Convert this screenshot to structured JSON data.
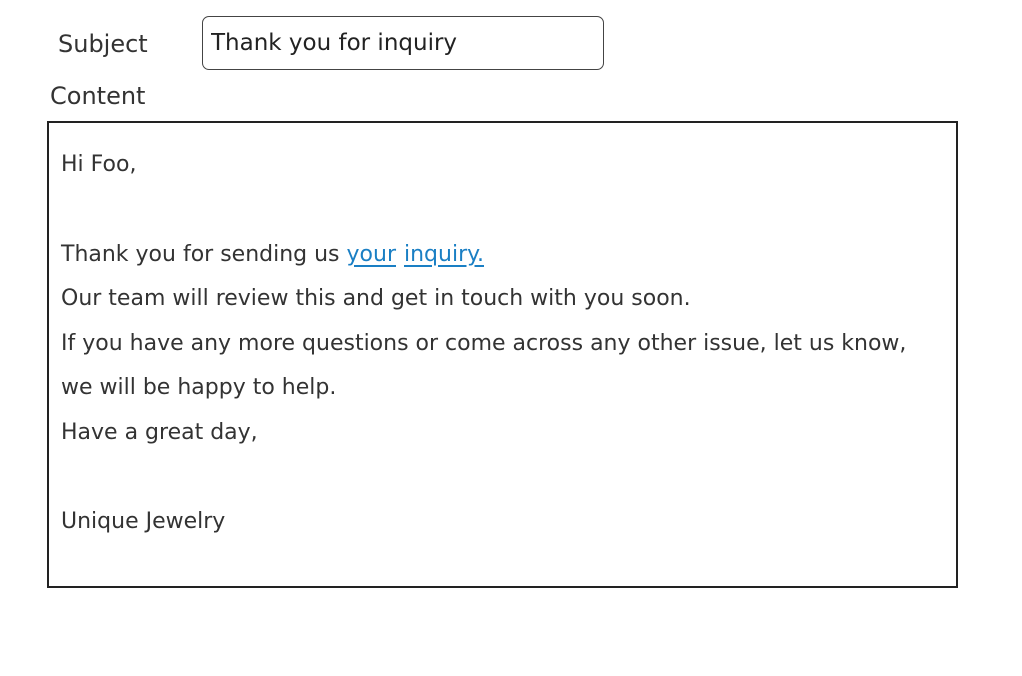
{
  "form": {
    "subject_label": "Subject",
    "subject_value": "Thank you for inquiry",
    "content_label": "Content"
  },
  "email": {
    "greeting": "Hi Foo,",
    "thanks_prefix": "Thank you for sending us ",
    "link_word_1": "your",
    "link_word_2": "inquiry.",
    "line_review": "Our team will review this and get in touch with you soon.",
    "line_questions": "If you have any more questions or come across any other issue, let us know,",
    "line_help": "we will be happy to help.",
    "line_closing": "Have a great day,",
    "signature": "Unique Jewelry"
  },
  "colors": {
    "link": "#1a7fc4",
    "text": "#333333",
    "border": "#222222"
  }
}
